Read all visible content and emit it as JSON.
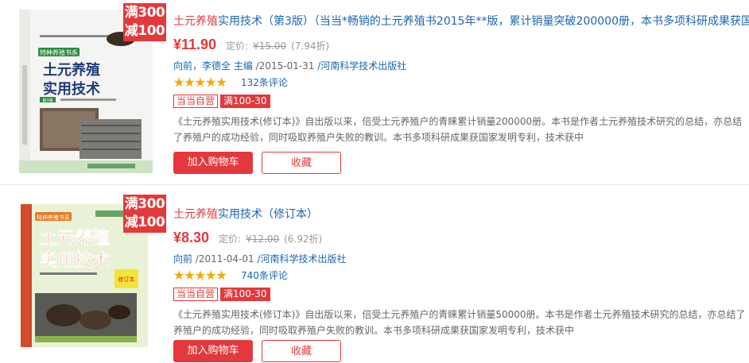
{
  "products": [
    {
      "promo_line1": "满300",
      "promo_line2": "减100",
      "title_highlight": "土元养殖",
      "title_rest": "实用技术（第3版）（当当*畅销的土元养殖书2015年**版，累计销量突破200000册，本书多项科研成果获国",
      "price": "¥11.90",
      "list_price_label": "定价:",
      "list_price": "¥15.00",
      "discount": "(7.94折)",
      "authors": "向前，李德全 主编",
      "date": "/2015-01-31",
      "publisher": "/河南科学技术出版社",
      "rating_percent": 100,
      "reviews": "132条评论",
      "tag_dangdang": "当当自营",
      "tag_promo": "满100-30",
      "description": "《土元养殖实用技术(修订本)》自出版以来，倍受土元养殖户的青睐累计销量200000册。本书是作者土元养殖技术研究的总结，亦总结了养殖户的成功经验，同时吸取养殖户失败的教训。本书多项科研成果获国家发明专利，技术获中",
      "add_to_cart": "加入购物车",
      "favorite": "收藏",
      "cover": {
        "series": "特种养殖书系",
        "title_line1": "土元养殖",
        "title_line2": "实用技术",
        "edition": "第3版"
      }
    },
    {
      "promo_line1": "满300",
      "promo_line2": "减100",
      "title_highlight": "土元养殖",
      "title_rest": "实用技术（修订本）",
      "price": "¥8.30",
      "list_price_label": "定价:",
      "list_price": "¥12.00",
      "discount": "(6.92折)",
      "authors": "向前",
      "date": "/2011-04-01",
      "publisher": "/河南科学技术出版社",
      "rating_percent": 90,
      "reviews": "740条评论",
      "tag_dangdang": "当当自营",
      "tag_promo": "满100-30",
      "description": "《土元养殖实用技术(修订本)》自出版以来，倍受土元养殖户的青睐累计销量50000册。本书是作者土元养殖技术研究的总结，亦总结了养殖户的成功经验，同时吸取养殖户失败的教训。本书多项科研成果获国家发明专利，技术获中",
      "add_to_cart": "加入购物车",
      "favorite": "收藏",
      "cover": {
        "series": "特种养殖书系",
        "title_line1": "土元养殖",
        "title_line2": "实用技术",
        "edition": "修订本"
      }
    }
  ],
  "colors": {
    "accent": "#e4393c",
    "link": "#1a66b3",
    "star": "#f8a800"
  }
}
